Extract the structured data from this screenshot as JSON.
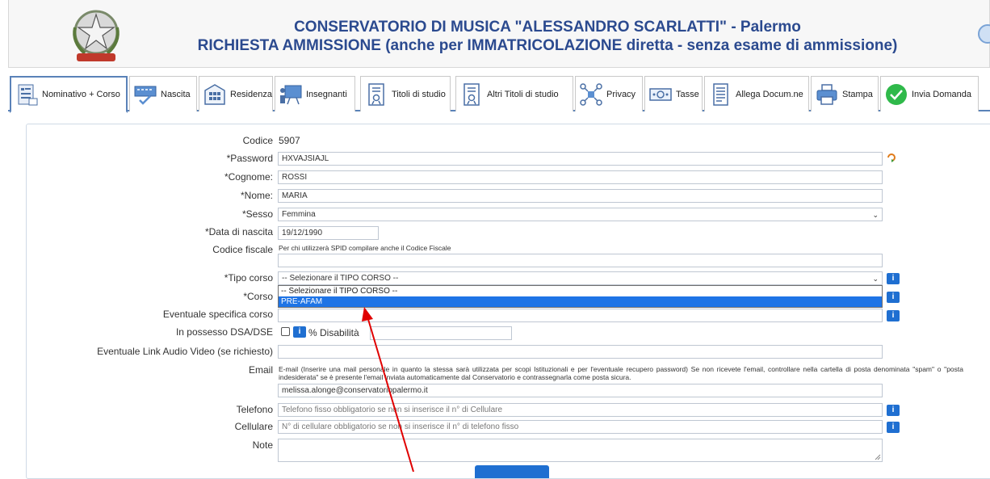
{
  "header": {
    "title_line1": "CONSERVATORIO DI MUSICA \"ALESSANDRO SCARLATTI\" - Palermo",
    "title_line2": "RICHIESTA AMMISSIONE (anche per IMMATRICOLAZIONE diretta - senza esame di ammissione)",
    "emblem_icon": "repubblica-italiana-emblem"
  },
  "tabs": [
    {
      "label": "Nominativo + Corso",
      "icon": "form-list-icon",
      "active": true
    },
    {
      "label": "Nascita",
      "icon": "keyboard-check-icon",
      "active": false
    },
    {
      "label": "Residenza",
      "icon": "building-icon",
      "active": false
    },
    {
      "label": "Insegnanti",
      "icon": "teacher-board-icon",
      "active": false
    },
    {
      "label": "Titoli di studio",
      "icon": "certificate-icon",
      "active": false
    },
    {
      "label": "Altri Titoli di studio",
      "icon": "certificate-icon",
      "active": false
    },
    {
      "label": "Privacy",
      "icon": "network-icon",
      "active": false
    },
    {
      "label": "Tasse",
      "icon": "payment-icon",
      "active": false
    },
    {
      "label": "Allega Docum.ne",
      "icon": "document-icon",
      "active": false
    },
    {
      "label": "Stampa",
      "icon": "printer-icon",
      "active": false
    },
    {
      "label": "Invia Domanda",
      "icon": "check-circle-icon",
      "active": false
    }
  ],
  "form": {
    "codice_label": "Codice",
    "codice_value": "5907",
    "password_label": "*Password",
    "password_value": "HXVAJSIAJL",
    "cognome_label": "*Cognome:",
    "cognome_value": "ROSSI",
    "nome_label": "*Nome:",
    "nome_value": "MARIA",
    "sesso_label": "*Sesso",
    "sesso_value": "Femmina",
    "data_nascita_label": "*Data di nascita",
    "data_nascita_value": "19/12/1990",
    "codice_fiscale_label": "Codice fiscale",
    "codice_fiscale_hint": "Per chi utilizzerà SPID compilare anche il Codice Fiscale",
    "tipo_corso_label": "*Tipo corso",
    "tipo_corso_value": "-- Selezionare il TIPO CORSO --",
    "tipo_corso_options": [
      "-- Selezionare il TIPO CORSO --",
      "PRE-AFAM"
    ],
    "corso_label": "*Corso",
    "specifica_label": "Eventuale specifica corso",
    "dsa_label": "In possesso DSA/DSE",
    "disabilita_label": "% Disabilità",
    "link_label": "Eventuale Link Audio Video (se richiesto)",
    "email_label": "Email",
    "email_hint": "E-mail (Inserire una mail personale in quanto la stessa sarà utilizzata per scopi Istituzionali e per l'eventuale recupero password) Se non ricevete l'email, controllare nella cartella di posta denominata \"spam\" o \"posta indesiderata\" se è presente l'email inviata automaticamente dal Conservatorio e contrassegnarla come posta sicura.",
    "email_value": "melissa.alonge@conservatoriopalermo.it",
    "telefono_label": "Telefono",
    "telefono_placeholder": "Telefono fisso obbligatorio se non si inserisce il n° di Cellulare",
    "cellulare_label": "Cellulare",
    "cellulare_placeholder": "N° di cellulare obbligatorio se non si inserisce il n° di telefono fisso",
    "note_label": "Note",
    "info_glyph": "i"
  },
  "colors": {
    "title": "#2b4a8f",
    "accent": "#1f6fd1",
    "annotation_arrow": "#e00000"
  }
}
